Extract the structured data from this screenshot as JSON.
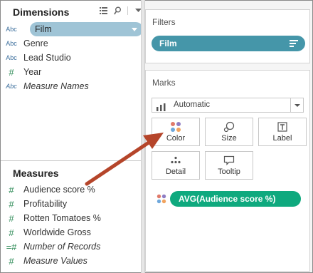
{
  "dimensions": {
    "title": "Dimensions",
    "items": [
      {
        "type_label": "Abc",
        "label": "Film"
      },
      {
        "type_label": "Abc",
        "label": "Genre"
      },
      {
        "type_label": "Abc",
        "label": "Lead Studio"
      },
      {
        "type_label": "#",
        "label": "Year"
      },
      {
        "type_label": "Abc",
        "label": "Measure Names"
      }
    ]
  },
  "measures": {
    "title": "Measures",
    "items": [
      {
        "type_label": "#",
        "label": "Audience  score %"
      },
      {
        "type_label": "#",
        "label": "Profitability"
      },
      {
        "type_label": "#",
        "label": "Rotten Tomatoes %"
      },
      {
        "type_label": "#",
        "label": "Worldwide Gross"
      },
      {
        "type_label": "=#",
        "label": "Number of Records"
      },
      {
        "type_label": "#",
        "label": "Measure Values"
      }
    ]
  },
  "filters": {
    "title": "Filters",
    "pill": "Film"
  },
  "marks": {
    "title": "Marks",
    "mark_type": "Automatic",
    "buttons": {
      "color": "Color",
      "size": "Size",
      "label": "Label",
      "detail": "Detail",
      "tooltip": "Tooltip"
    },
    "color_pill": "AVG(Audience  score %)"
  },
  "colors": {
    "dimension_pill": "#9fc4d6",
    "filter_pill": "#4596a9",
    "measure_pill": "#0fa97e",
    "arrow": "#b5452a"
  },
  "icons": {
    "toolbar": [
      "view-toggle-icon",
      "search-icon",
      "menu-caret-icon"
    ],
    "marks": [
      "color-dots-icon",
      "size-icon",
      "label-icon",
      "detail-icon",
      "tooltip-icon"
    ]
  }
}
